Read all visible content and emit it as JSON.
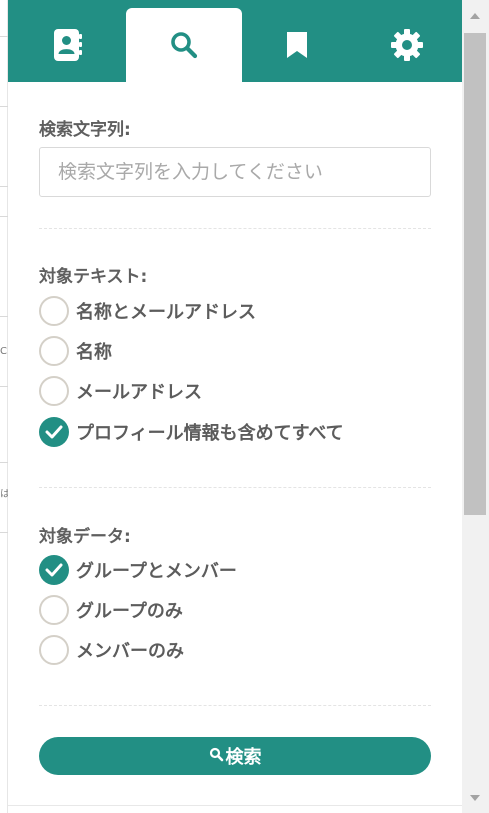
{
  "left_strip": {
    "glyphs": [
      "C",
      "は"
    ]
  },
  "tabs": [
    {
      "icon": "address-book-icon",
      "active": false
    },
    {
      "icon": "search-icon",
      "active": true
    },
    {
      "icon": "bookmark-icon",
      "active": false
    },
    {
      "icon": "gear-icon",
      "active": false
    }
  ],
  "colors": {
    "accent": "#228f84",
    "label": "#5f5f5f",
    "placeholder": "#a9a9a9",
    "radio_border": "#d4d0c8",
    "scroll_thumb": "#c1c1c1"
  },
  "search": {
    "label": "検索文字列:",
    "value": "",
    "placeholder": "検索文字列を入力してください"
  },
  "target_text": {
    "label": "対象テキスト:",
    "options": [
      {
        "label": "名称とメールアドレス",
        "checked": false
      },
      {
        "label": "名称",
        "checked": false
      },
      {
        "label": "メールアドレス",
        "checked": false
      },
      {
        "label": "プロフィール情報も含めてすべて",
        "checked": true
      }
    ]
  },
  "target_data": {
    "label": "対象データ:",
    "options": [
      {
        "label": "グループとメンバー",
        "checked": true
      },
      {
        "label": "グループのみ",
        "checked": false
      },
      {
        "label": "メンバーのみ",
        "checked": false
      }
    ]
  },
  "search_button": {
    "icon": "search-icon",
    "label": "検索"
  },
  "scrollbar": {
    "up_icon": "arrow-up-icon",
    "down_icon": "arrow-down-icon"
  }
}
